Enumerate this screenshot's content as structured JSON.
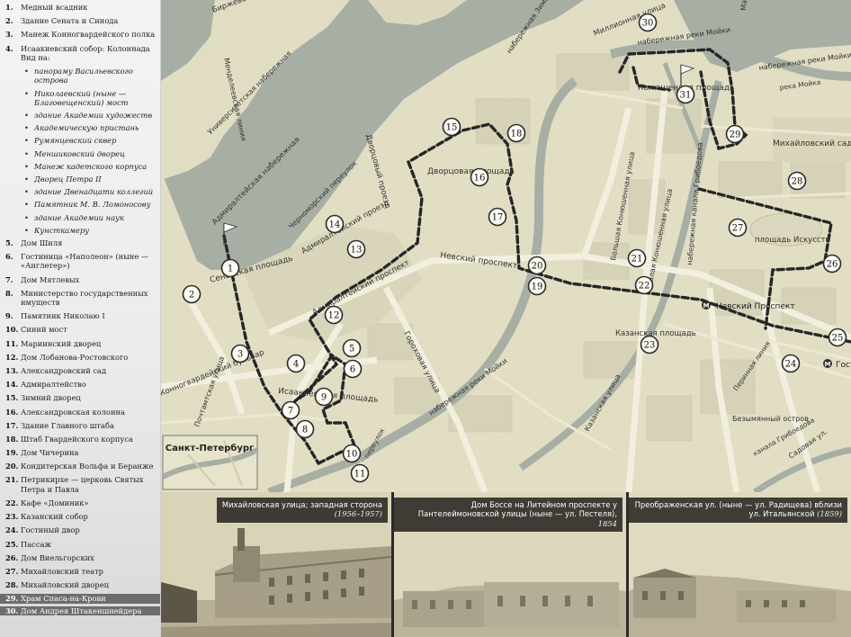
{
  "legend": [
    {
      "num": "1.",
      "label": "Медный всадник"
    },
    {
      "num": "2.",
      "label": "Здание Сената и Синода"
    },
    {
      "num": "3.",
      "label": "Манеж Конногвардейского полка"
    },
    {
      "num": "4.",
      "label": "Исаакиевский собор: Колоннада Вид на:"
    },
    {
      "sub": true,
      "label": "панораму Васильевского острова"
    },
    {
      "sub": true,
      "label": "Николаевский (ныне — Благовещенский) мост"
    },
    {
      "sub": true,
      "label": "здание Академии художеств"
    },
    {
      "sub": true,
      "label": "Академическую пристань"
    },
    {
      "sub": true,
      "label": "Румянцевский сквер"
    },
    {
      "sub": true,
      "label": "Меншиковский дворец"
    },
    {
      "sub": true,
      "label": "Манеж кадетского корпуса"
    },
    {
      "sub": true,
      "label": "Дворец Петра II"
    },
    {
      "sub": true,
      "label": "здание Двенадцати коллегий"
    },
    {
      "sub": true,
      "label": "Памятник М. В. Ломоносову"
    },
    {
      "sub": true,
      "label": "здание Академии наук"
    },
    {
      "sub": true,
      "label": "Кунсткамеру"
    },
    {
      "num": "5.",
      "label": "Дом Шиля"
    },
    {
      "num": "6.",
      "label": "Гостиница «Наполеон» (ныне — «Англетер»)"
    },
    {
      "num": "7.",
      "label": "Дом Мятлевых"
    },
    {
      "num": "8.",
      "label": "Министерство государственных имуществ"
    },
    {
      "num": "9.",
      "label": "Памятник Николаю I"
    },
    {
      "num": "10.",
      "label": "Синий мост"
    },
    {
      "num": "11.",
      "label": "Мариинский дворец"
    },
    {
      "num": "12.",
      "label": "Дом Лобанова-Ростовского"
    },
    {
      "num": "13.",
      "label": "Александровский сад"
    },
    {
      "num": "14.",
      "label": "Адмиралтейство"
    },
    {
      "num": "15.",
      "label": "Зимний дворец"
    },
    {
      "num": "16.",
      "label": "Александровская колонна"
    },
    {
      "num": "17.",
      "label": "Здание Главного штаба"
    },
    {
      "num": "18.",
      "label": "Штаб Гвардейского корпуса"
    },
    {
      "num": "19.",
      "label": "Дом Чичерина"
    },
    {
      "num": "20.",
      "label": "Кондитерская Вольфа и Беранже"
    },
    {
      "num": "21.",
      "label": "Петрикирхе — церковь Святых Петра и Павла"
    },
    {
      "num": "22.",
      "label": "Кафе «Доминик»"
    },
    {
      "num": "23.",
      "label": "Казанский собор"
    },
    {
      "num": "24.",
      "label": "Гостиный двор"
    },
    {
      "num": "25.",
      "label": "Пассаж"
    },
    {
      "num": "26.",
      "label": "Дом Виельгорских"
    },
    {
      "num": "27.",
      "label": "Михайловский театр"
    },
    {
      "num": "28.",
      "label": "Михайловский дворец"
    },
    {
      "num": "29.",
      "label": "Храм Спаса-на-Крови",
      "dark": true
    },
    {
      "num": "30.",
      "label": "Дом Андрея Штакеншнейдера",
      "dark": true
    }
  ],
  "map": {
    "street_labels": {
      "birzh": "Биржевой пр.",
      "mendel": "Менделеевская линия",
      "univ": "Университетская набережная",
      "milli": "Миллионная улица",
      "moika_emb": "набережная реки Мойки",
      "marsovo": "Марсово Поле",
      "moika_emb2": "набережная реки Мойки",
      "moika_river": "река Мойка",
      "zimnei": "набережная Зимней канавки",
      "dvortsovy": "Дворцовый проезд",
      "admir_emb": "Адмиралтейская набережная",
      "chernomor": "Черноморский переулок",
      "admir_pr": "Адмиралтейский проезд",
      "admir_prosp": "Адмиралтейский проспект",
      "dvorts_pl": "Дворцовая площадь",
      "konyush": "Конюшенная площадь",
      "mikh_sad": "Михайловский сад",
      "b_kon": "Большая Конюшенная улица",
      "m_kon": "Малая Конюшенная улица",
      "griboed": "набережная канала Грибоедова",
      "pl_isk": "площадь Искусств",
      "nevsky": "Невский проспект",
      "senat": "Сенатская площадь",
      "konnogv": "Конногвардейский бульвар",
      "pochtamt": "Почтамтская улица",
      "isaak_pl": "Исаакиевская площадь",
      "gorokh": "Гороховая улица",
      "moika_emb3": "набережная реки Мойки",
      "kazan_pl": "Казанская площадь",
      "kazan_ul": "Казанская улица",
      "bezym": "Безымянный остров",
      "gribo2": "канала Грибоедова",
      "perinnaya": "Перинная линия",
      "sadovaya": "Садовая ул.",
      "pereulok": "переулок",
      "inset": "Санкт-Петербург"
    },
    "metro": [
      {
        "label": "Невский Проспект"
      },
      {
        "label": "Гостиный двор"
      }
    ],
    "markers": [
      "1",
      "2",
      "3",
      "4",
      "5",
      "6",
      "7",
      "8",
      "9",
      "10",
      "11",
      "12",
      "13",
      "14",
      "15",
      "16",
      "17",
      "18",
      "19",
      "20",
      "21",
      "22",
      "23",
      "24",
      "25",
      "26",
      "27",
      "28",
      "29",
      "30",
      "31"
    ],
    "colors": {
      "water": "#aab2a8",
      "land": "#e4e0c6",
      "block": "#d3d0b5",
      "route": "#2b2b2b"
    }
  },
  "photos": [
    {
      "title": "Михайловская улица; западная сторона",
      "year": "(1956–1957)"
    },
    {
      "title": "Дом Боссе на Литейном проспекте у Пантелеймоновской улицы (ныне — ул. Пестеля),",
      "year": "1854"
    },
    {
      "title": "Преображенская ул. (ныне — ул. Радищева) вблизи ул. Итальянской",
      "year": "(1859)"
    }
  ]
}
